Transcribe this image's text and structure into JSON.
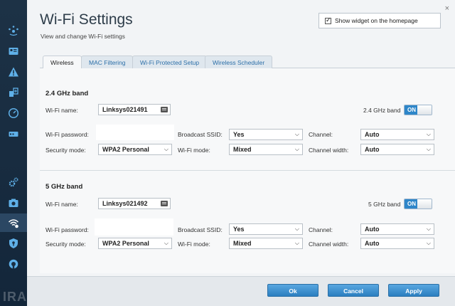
{
  "nav": {
    "items": [
      {
        "icon": "network-map-icon"
      },
      {
        "icon": "device-list-icon"
      },
      {
        "icon": "alert-icon"
      },
      {
        "icon": "media-prioritization-icon"
      },
      {
        "icon": "speed-test-icon"
      },
      {
        "icon": "external-storage-icon"
      },
      {
        "icon": "settings-icon"
      },
      {
        "icon": "camera-icon"
      },
      {
        "icon": "wifi-icon"
      },
      {
        "icon": "security-icon"
      },
      {
        "icon": "troubleshoot-icon"
      }
    ],
    "watermark": "IRANSSO.COM"
  },
  "page": {
    "title": "Wi-Fi Settings",
    "subtitle": "View and change Wi-Fi settings",
    "widget_label": "Show widget on the homepage",
    "widget_checked": true,
    "close": "×"
  },
  "tabs": [
    {
      "label": "Wireless",
      "active": true
    },
    {
      "label": "MAC Filtering",
      "active": false
    },
    {
      "label": "Wi-Fi Protected Setup",
      "active": false
    },
    {
      "label": "Wireless Scheduler",
      "active": false
    }
  ],
  "band24": {
    "title": "2.4 GHz band",
    "wifi_name_label": "Wi-Fi name:",
    "wifi_name": "Linksys021491",
    "toggle_label": "2.4 GHz band",
    "toggle_value": "ON",
    "password_label": "Wi-Fi password:",
    "broadcast_label": "Broadcast SSID:",
    "broadcast_value": "Yes",
    "channel_label": "Channel:",
    "channel_value": "Auto",
    "security_label": "Security mode:",
    "security_value": "WPA2 Personal",
    "mode_label": "Wi-Fi mode:",
    "mode_value": "Mixed",
    "width_label": "Channel width:",
    "width_value": "Auto"
  },
  "band5": {
    "title": "5 GHz band",
    "wifi_name_label": "Wi-Fi name:",
    "wifi_name": "Linksys021492",
    "toggle_label": "5 GHz band",
    "toggle_value": "ON",
    "password_label": "Wi-Fi password:",
    "broadcast_label": "Broadcast SSID:",
    "broadcast_value": "Yes",
    "channel_label": "Channel:",
    "channel_value": "Auto",
    "security_label": "Security mode:",
    "security_value": "WPA2 Personal",
    "mode_label": "Wi-Fi mode:",
    "mode_value": "Mixed",
    "width_label": "Channel width:",
    "width_value": "Auto"
  },
  "footer": {
    "ok": "Ok",
    "cancel": "Cancel",
    "apply": "Apply"
  },
  "colors": {
    "accent": "#2e86c9",
    "nav_bg": "#1a2e42"
  }
}
